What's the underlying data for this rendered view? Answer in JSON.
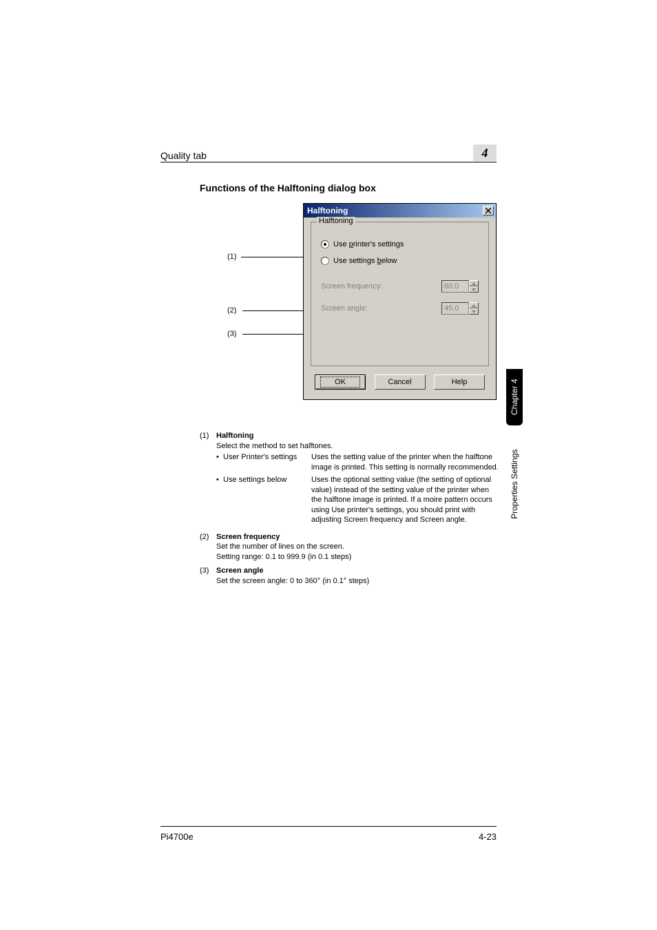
{
  "header": {
    "title": "Quality tab",
    "chapter_number": "4"
  },
  "section_heading": "Functions of the Halftoning dialog box",
  "callouts": {
    "c1": "(1)",
    "c2": "(2)",
    "c3": "(3)"
  },
  "dialog": {
    "title": "Halftoning",
    "close_icon": "close-icon",
    "group_label": "Halftoning",
    "radio1_pre": "Use ",
    "radio1_u": "p",
    "radio1_post": "rinter's settings",
    "radio2_pre": "Use settings ",
    "radio2_u": "b",
    "radio2_post": "elow",
    "freq_label": "Screen frequency:",
    "freq_value": "60.0",
    "angle_label": "Screen angle:",
    "angle_value": "45.0",
    "ok": "OK",
    "cancel": "Cancel",
    "help": "Help"
  },
  "sidetab_chapter": "Chapter 4",
  "sidetab_props": "Properties Settings",
  "explain": {
    "items": [
      {
        "num": "(1)",
        "title": "Halftoning",
        "desc": "Select the method to set halftones.",
        "subs": [
          {
            "label": "User Printer's settings",
            "text": "Uses the setting value of the printer when the halftone image is printed. This setting is normally recommended."
          },
          {
            "label": "Use settings below",
            "text": "Uses the optional setting value (the setting of optional value) instead of the setting value of the printer when the halftone image is printed. If a moire pattern occurs using Use printer's settings, you should print with adjusting Screen frequency and Screen angle."
          }
        ]
      },
      {
        "num": "(2)",
        "title": "Screen frequency",
        "desc": "Set the number of lines on the screen.",
        "desc2": "Setting range: 0.1 to 999.9 (in 0.1 steps)"
      },
      {
        "num": "(3)",
        "title": "Screen angle",
        "desc": "Set the screen angle: 0 to 360° (in 0.1° steps)"
      }
    ]
  },
  "footer": {
    "left": "Pi4700e",
    "right": "4-23"
  }
}
